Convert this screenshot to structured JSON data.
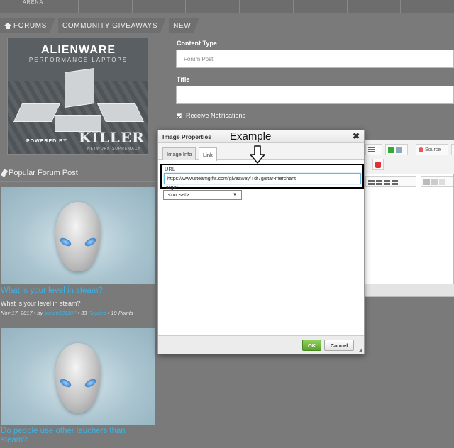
{
  "topbar": {
    "brand": "ARENA"
  },
  "breadcrumb": [
    {
      "label": "FORUMS",
      "icon": "home-icon"
    },
    {
      "label": "COMMUNITY GIVEAWAYS"
    },
    {
      "label": "NEW"
    }
  ],
  "ad": {
    "title": "ALIENWARE",
    "subtitle": "PERFORMANCE LAPTOPS",
    "powered": "POWERED BY",
    "killer": "KILLER",
    "killer_sub": "NETWORK SUPREMACY"
  },
  "sidebar": {
    "heading": "Popular Forum Post",
    "posts": [
      {
        "title": "What is your level in steam?",
        "excerpt": "What is your level in steam?",
        "date": "Nov 17, 2017",
        "by": "by",
        "author": "steam101107",
        "replies_count": "33",
        "replies_label": "Replies",
        "points": "19 Points"
      },
      {
        "title": "Do people use other lauchers than steam?"
      }
    ]
  },
  "form": {
    "content_type_label": "Content Type",
    "content_type_value": "Forum Post",
    "title_label": "Title",
    "title_value": "",
    "notifications_label": "Receive Notifications"
  },
  "editor": {
    "source_label": "Source"
  },
  "dialog": {
    "title": "Image Properties",
    "close": "✖",
    "tabs": [
      "Image Info",
      "Link"
    ],
    "url_label": "URL",
    "url_value_pre": "https://www.steamgifts.com/giveaway/",
    "url_value_code": "Tdt7g",
    "url_value_post": "/star-merchant",
    "target_label": "Target",
    "target_value": "<not set>",
    "ok": "OK",
    "cancel": "Cancel"
  },
  "annotation": {
    "text": "Example"
  },
  "colors": {
    "accent_link": "#3db3e6",
    "ok_green": "#5aa32c",
    "highlight_border": "#000000"
  }
}
